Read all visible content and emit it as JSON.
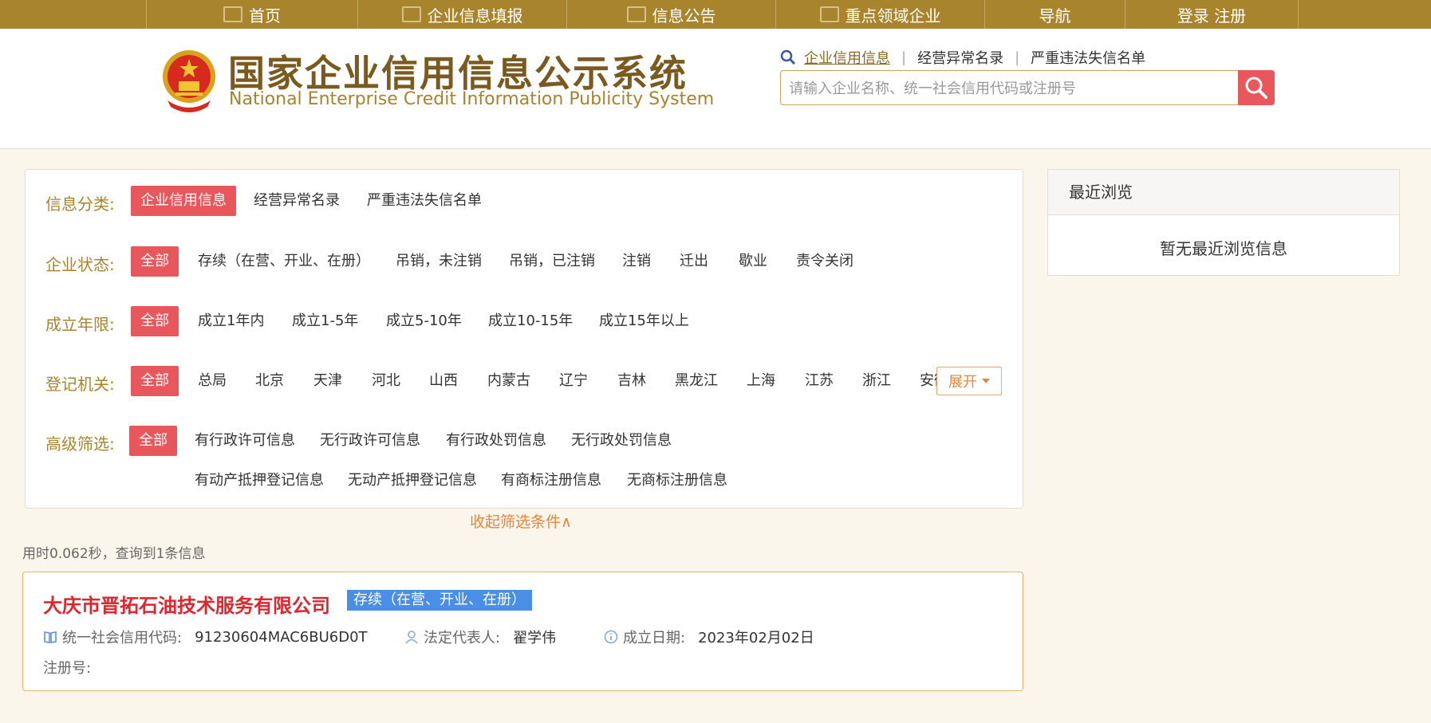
{
  "topnav": {
    "items": [
      {
        "label": "首页",
        "icon": "home-icon"
      },
      {
        "label": "企业信息填报",
        "icon": "edit-icon"
      },
      {
        "label": "信息公告",
        "icon": "document-icon"
      },
      {
        "label": "重点领域企业",
        "icon": "speaker-icon"
      },
      {
        "label": "导航"
      },
      {
        "label": "登录  注册"
      }
    ]
  },
  "header": {
    "title_cn": "国家企业信用信息公示系统",
    "title_en": "National Enterprise Credit Information Publicity System"
  },
  "search": {
    "links": [
      "企业信用信息",
      "经营异常名录",
      "严重违法失信名单"
    ],
    "placeholder": "请输入企业名称、统一社会信用代码或注册号",
    "button_icon": "search-icon"
  },
  "filters": {
    "category": {
      "label": "信息分类:",
      "options": [
        "企业信用信息",
        "经营异常名录",
        "严重违法失信名单"
      ]
    },
    "status": {
      "label": "企业状态:",
      "options": [
        "全部",
        "存续（在营、开业、在册）",
        "吊销，未注销",
        "吊销，已注销",
        "注销",
        "迁出",
        "歇业",
        "责令关闭"
      ]
    },
    "years": {
      "label": "成立年限:",
      "options": [
        "全部",
        "成立1年内",
        "成立1-5年",
        "成立5-10年",
        "成立10-15年",
        "成立15年以上"
      ]
    },
    "authority": {
      "label": "登记机关:",
      "options": [
        "全部",
        "总局",
        "北京",
        "天津",
        "河北",
        "山西",
        "内蒙古",
        "辽宁",
        "吉林",
        "黑龙江",
        "上海",
        "江苏",
        "浙江",
        "安徽"
      ],
      "expand_label": "展开"
    },
    "advanced": {
      "label": "高级筛选:",
      "options": [
        "全部",
        "有行政许可信息",
        "无行政许可信息",
        "有行政处罚信息",
        "无行政处罚信息",
        "有动产抵押登记信息",
        "无动产抵押登记信息",
        "有商标注册信息",
        "无商标注册信息"
      ]
    },
    "collapse_label": "收起筛选条件∧"
  },
  "results": {
    "summary": "用时0.062秒，查询到1条信息",
    "items": [
      {
        "company_name": "大庆市晋拓石油技术服务有限公司",
        "status": "存续（在营、开业、在册）",
        "credit_code_label": "统一社会信用代码:",
        "credit_code": "91230604MAC6BU6D0T",
        "legal_rep_label": "法定代表人:",
        "legal_rep": "翟学伟",
        "founded_label": "成立日期:",
        "founded": "2023年02月02日",
        "reg_no_label": "注册号:",
        "reg_no": ""
      }
    ]
  },
  "recent": {
    "title": "最近浏览",
    "empty": "暂无最近浏览信息"
  },
  "colors": {
    "gold": "#a8852d",
    "accent_red": "#e8575b",
    "badge_blue": "#4a8ee6",
    "company_red": "#e0262d"
  }
}
